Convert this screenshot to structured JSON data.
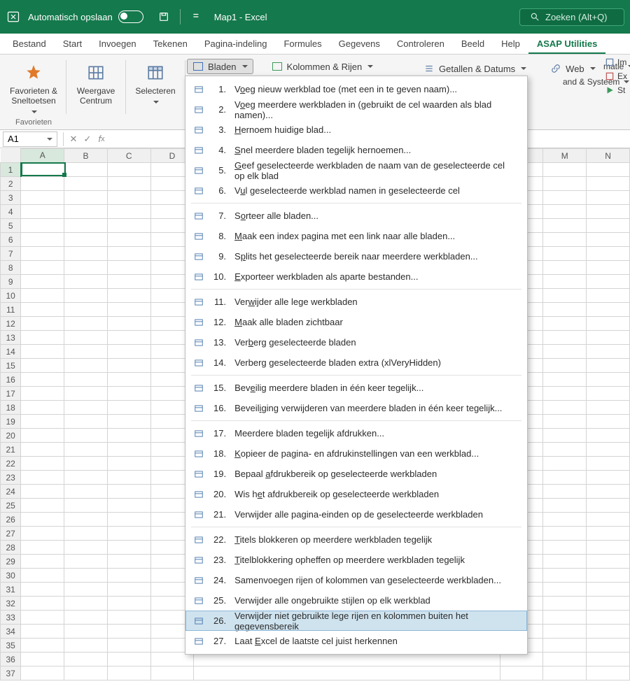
{
  "titlebar": {
    "autosave_label": "Automatisch opslaan",
    "doc_title": "Map1 - Excel",
    "search_placeholder": "Zoeken (Alt+Q)"
  },
  "tabs": [
    "Bestand",
    "Start",
    "Invoegen",
    "Tekenen",
    "Pagina-indeling",
    "Formules",
    "Gegevens",
    "Controleren",
    "Beeld",
    "Help",
    "ASAP Utilities"
  ],
  "active_tab_index": 10,
  "ribbon": {
    "favorieten": {
      "label": "Favorieten &\nSneltoetsen",
      "group": "Favorieten"
    },
    "weergave": {
      "label": "Weergave\nCentrum"
    },
    "selecteren": {
      "label": "Selecteren"
    },
    "bladen": "Bladen",
    "kolommen": "Kolommen & Rijen",
    "getallen": "Getallen & Datums",
    "web": "Web",
    "overflow": {
      "im": "Im",
      "ex": "Ex",
      "st": "St",
      "matie": "matie",
      "systeem": "and & Systeem"
    }
  },
  "namebox": "A1",
  "columns": [
    "A",
    "B",
    "C",
    "D",
    "",
    "",
    "",
    "",
    "",
    "",
    "",
    "L",
    "M",
    "N"
  ],
  "visible_cols_left": [
    "A",
    "B",
    "C",
    "D"
  ],
  "visible_cols_right": [
    "L",
    "M",
    "N"
  ],
  "row_count": 37,
  "menu": {
    "groups": [
      [
        {
          "n": "1",
          "t": "Voeg nieuw werkblad toe (met een in te geven naam)...",
          "u": 1
        },
        {
          "n": "2",
          "t": "Voeg meerdere werkbladen in (gebruikt de cel waarden als blad namen)...",
          "u": 1
        },
        {
          "n": "3",
          "t": "Hernoem huidige blad...",
          "u": 0
        },
        {
          "n": "4",
          "t": "Snel meerdere bladen tegelijk hernoemen...",
          "u": 0
        },
        {
          "n": "5",
          "t": "Geef geselecteerde werkbladen de naam van de geselecteerde cel op elk blad",
          "u": 0
        },
        {
          "n": "6",
          "t": "Vul geselecteerde werkblad namen in  geselecteerde cel",
          "u": 1
        }
      ],
      [
        {
          "n": "7",
          "t": "Sorteer alle bladen...",
          "u": 1
        },
        {
          "n": "8",
          "t": "Maak een index pagina met een link naar alle bladen...",
          "u": 0
        },
        {
          "n": "9",
          "t": "Splits het geselecteerde bereik naar meerdere werkbladen...",
          "u": 1
        },
        {
          "n": "10",
          "t": "Exporteer werkbladen als aparte bestanden...",
          "u": 0
        }
      ],
      [
        {
          "n": "11",
          "t": "Verwijder alle lege werkbladen",
          "u": 3
        },
        {
          "n": "12",
          "t": "Maak alle bladen zichtbaar",
          "u": 0
        },
        {
          "n": "13",
          "t": "Verberg geselecteerde bladen",
          "u": 3
        },
        {
          "n": "14",
          "t": "Verberg geselecteerde bladen extra (xlVeryHidden)",
          "u": -1
        }
      ],
      [
        {
          "n": "15",
          "t": "Beveilig meerdere bladen in één keer tegelijk...",
          "u": 3
        },
        {
          "n": "16",
          "t": "Beveiliging verwijderen van meerdere bladen in één keer tegelijk...",
          "u": 6
        }
      ],
      [
        {
          "n": "17",
          "t": "Meerdere bladen tegelijk afdrukken...",
          "u": -1
        },
        {
          "n": "18",
          "t": "Kopieer de pagina- en afdrukinstellingen van een werkblad...",
          "u": 0
        },
        {
          "n": "19",
          "t": "Bepaal afdrukbereik op geselecteerde werkbladen",
          "u": 7
        },
        {
          "n": "20",
          "t": "Wis het afdrukbereik op geselecteerde werkbladen",
          "u": 5
        },
        {
          "n": "21",
          "t": "Verwijder alle pagina-einden op de geselecteerde werkbladen",
          "u": -1
        }
      ],
      [
        {
          "n": "22",
          "t": "Titels blokkeren op meerdere werkbladen tegelijk",
          "u": 0
        },
        {
          "n": "23",
          "t": "Titelblokkering opheffen op meerdere werkbladen tegelijk",
          "u": 0
        },
        {
          "n": "24",
          "t": "Samenvoegen rijen of kolommen van geselecteerde werkbladen...",
          "u": -1
        },
        {
          "n": "25",
          "t": "Verwijder alle ongebruikte stijlen op elk werkblad",
          "u": -1
        },
        {
          "n": "26",
          "t": "Verwijder niet gebruikte lege rijen en kolommen buiten het gegevensbereik",
          "u": -1
        },
        {
          "n": "27",
          "t": "Laat Excel de laatste cel juist herkennen",
          "u": 5
        }
      ]
    ],
    "highlight": "26"
  }
}
